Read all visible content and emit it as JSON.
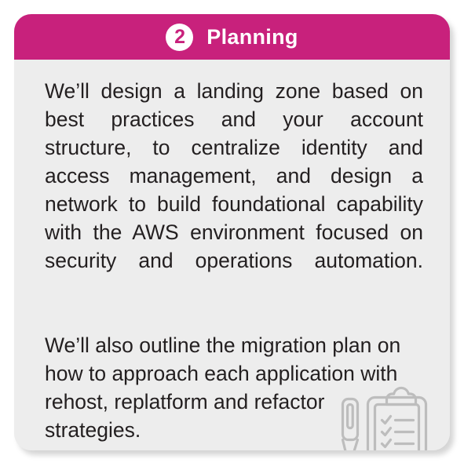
{
  "card": {
    "header": {
      "step_number": "2",
      "title": "Planning",
      "background_color": "#c8217c",
      "text_color": "#ffffff",
      "badge_fill": "#ffffff"
    },
    "body": {
      "background_color": "#ededed",
      "text_color": "#231f20",
      "paragraphs": [
        {
          "align": "justify",
          "text": "We’ll design a landing zone based on best practices and your account structure, to centralize identity and access management, and design a network to build foundational capability with the AWS environment focused on security and operations automation."
        },
        {
          "align": "left",
          "text": "We’ll also outline the migration plan on how to approach each application with rehost, replatform and refactor strategies."
        }
      ]
    },
    "illustration": {
      "name": "clipboard-checklist-and-pen",
      "stroke_color": "#bdbdbd",
      "checklist_rows": 3
    }
  },
  "page": {
    "background_color": "#ffffff"
  }
}
